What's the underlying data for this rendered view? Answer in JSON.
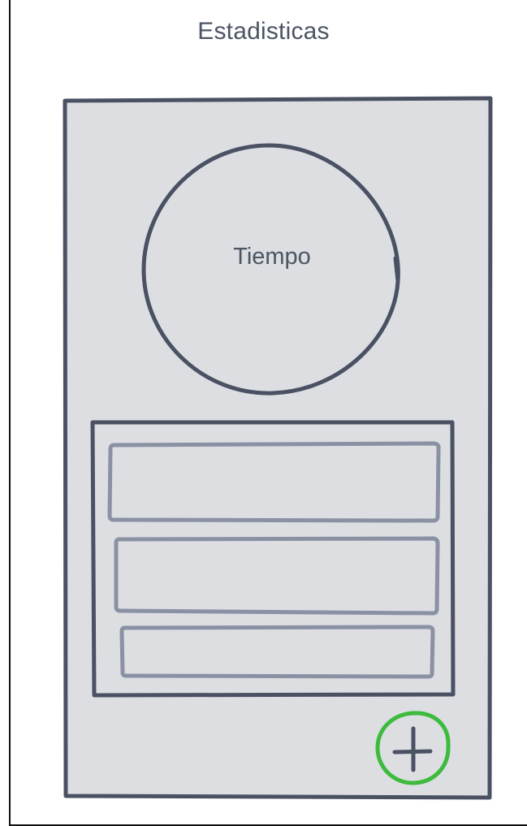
{
  "header": {
    "title": "Estadisticas"
  },
  "timer": {
    "label": "Tiempo"
  },
  "stats_list": {
    "rows": [
      "",
      "",
      ""
    ]
  },
  "fab": {
    "icon": "plus-icon",
    "accent_color": "#3dbb3d"
  },
  "colors": {
    "card_fill": "#dcdee2",
    "stroke_dark": "#4a5163",
    "stroke_light": "#8a91a3",
    "title_text": "#4b5563"
  }
}
